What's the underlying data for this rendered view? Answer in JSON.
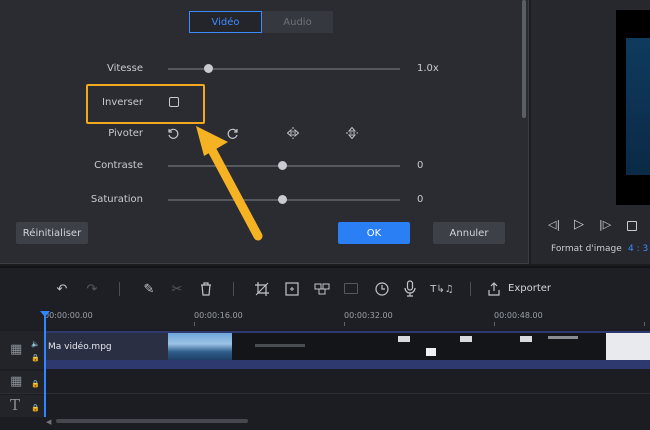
{
  "tabs": {
    "video": "Vidéo",
    "audio": "Audio"
  },
  "rows": {
    "speed": {
      "label": "Vitesse",
      "value": "1.0x"
    },
    "reverse": {
      "label": "Inverser"
    },
    "rotate": {
      "label": "Pivoter"
    },
    "contrast": {
      "label": "Contraste",
      "value": "0"
    },
    "saturation": {
      "label": "Saturation",
      "value": "0"
    }
  },
  "buttons": {
    "reset": "Réinitialiser",
    "ok": "OK",
    "cancel": "Annuler"
  },
  "preview": {
    "format_label": "Format d'image",
    "format_value": "4 : 3"
  },
  "toolbar": {
    "export": "Exporter"
  },
  "ruler": [
    "00:00:00.00",
    "00:00:16.00",
    "00:00:32.00",
    "00:00:48.00"
  ],
  "clip": {
    "name": "Ma vidéo.mpg"
  },
  "colors": {
    "accent": "#2b7ff5",
    "highlight": "#f0a81e",
    "arrow": "#f5b324"
  }
}
